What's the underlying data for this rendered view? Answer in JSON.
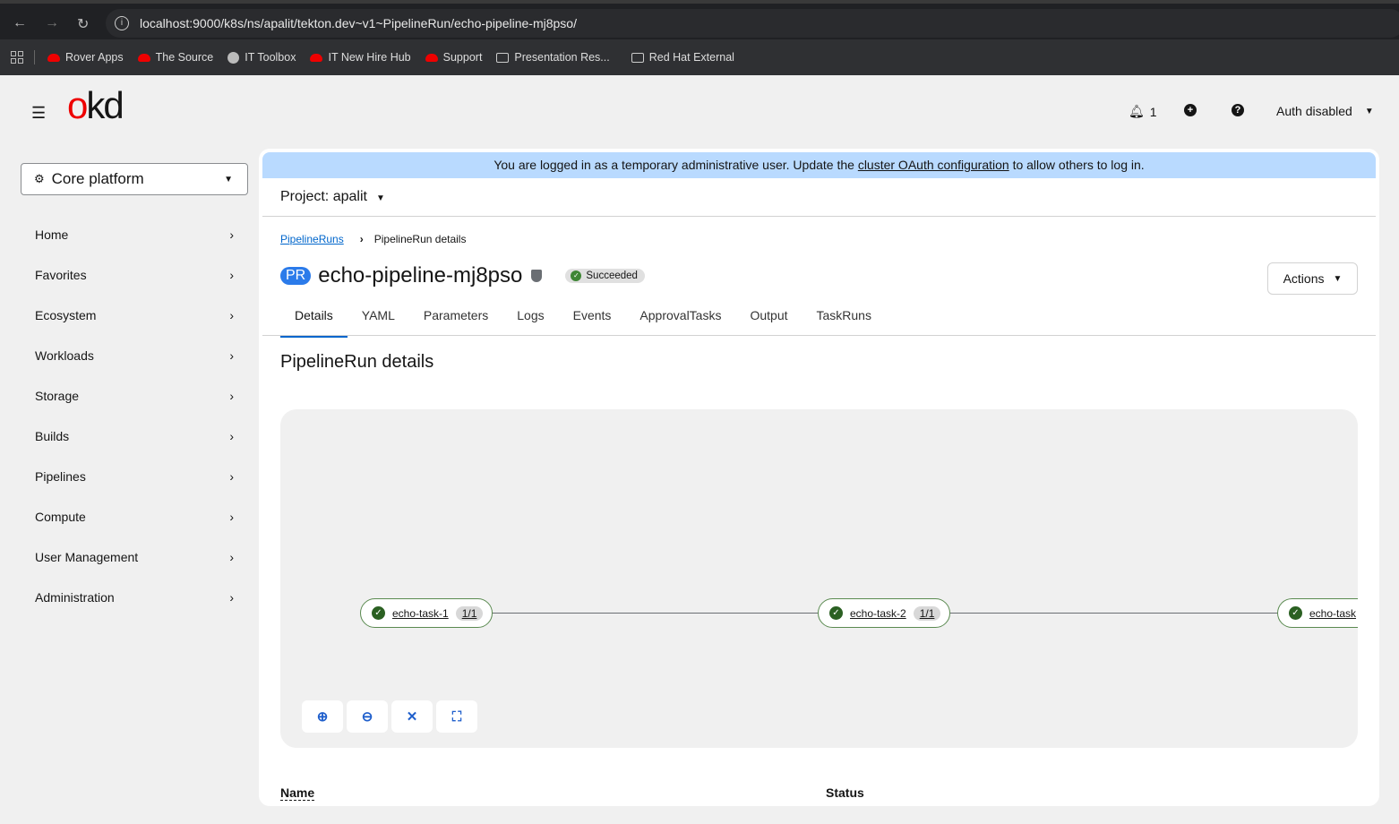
{
  "browser": {
    "url": "localhost:9000/k8s/ns/apalit/tekton.dev~v1~PipelineRun/echo-pipeline-mj8pso/",
    "bookmarks": [
      {
        "label": "Rover Apps",
        "icon": "redhat"
      },
      {
        "label": "The Source",
        "icon": "redhat"
      },
      {
        "label": "IT Toolbox",
        "icon": "globe"
      },
      {
        "label": "IT New Hire Hub",
        "icon": "redhat"
      },
      {
        "label": "Support",
        "icon": "redhat"
      },
      {
        "label": "Presentation Res...",
        "icon": "folder"
      },
      {
        "label": "Red Hat External",
        "icon": "folder"
      }
    ]
  },
  "masthead": {
    "logo": "okd",
    "notifications": "1",
    "user": "Auth disabled"
  },
  "sidebar": {
    "perspective": "Core platform",
    "items": [
      "Home",
      "Favorites",
      "Ecosystem",
      "Workloads",
      "Storage",
      "Builds",
      "Pipelines",
      "Compute",
      "User Management",
      "Administration"
    ]
  },
  "banner": {
    "pre": "You are logged in as a temporary administrative user. Update the ",
    "link": "cluster OAuth configuration",
    "post": " to allow others to log in."
  },
  "project": "Project: apalit",
  "breadcrumb": {
    "parent": "PipelineRuns",
    "current": "PipelineRun details"
  },
  "resource": {
    "kind_badge": "PR",
    "name": "echo-pipeline-mj8pso",
    "status": "Succeeded",
    "actions": "Actions"
  },
  "tabs": [
    "Details",
    "YAML",
    "Parameters",
    "Logs",
    "Events",
    "ApprovalTasks",
    "Output",
    "TaskRuns"
  ],
  "section_title": "PipelineRun details",
  "graph": {
    "nodes": [
      {
        "name": "echo-task-1",
        "count": "1/1"
      },
      {
        "name": "echo-task-2",
        "count": "1/1"
      },
      {
        "name": "echo-task",
        "count": ""
      }
    ]
  },
  "table": {
    "headers": [
      "Name",
      "Status"
    ]
  }
}
